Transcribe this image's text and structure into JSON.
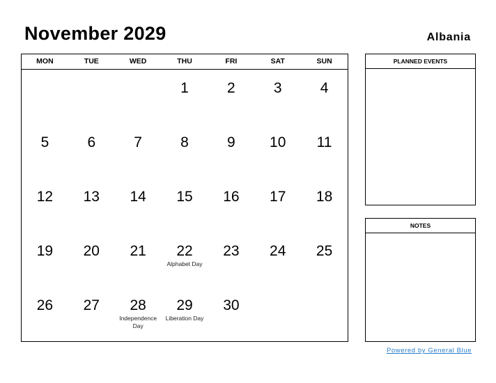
{
  "header": {
    "title": "November 2029",
    "country": "Albania"
  },
  "calendar": {
    "weekdays": [
      "MON",
      "TUE",
      "WED",
      "THU",
      "FRI",
      "SAT",
      "SUN"
    ],
    "weeks": [
      [
        {
          "day": ""
        },
        {
          "day": ""
        },
        {
          "day": ""
        },
        {
          "day": "1"
        },
        {
          "day": "2"
        },
        {
          "day": "3"
        },
        {
          "day": "4"
        }
      ],
      [
        {
          "day": "5"
        },
        {
          "day": "6"
        },
        {
          "day": "7"
        },
        {
          "day": "8"
        },
        {
          "day": "9"
        },
        {
          "day": "10"
        },
        {
          "day": "11"
        }
      ],
      [
        {
          "day": "12"
        },
        {
          "day": "13"
        },
        {
          "day": "14"
        },
        {
          "day": "15"
        },
        {
          "day": "16"
        },
        {
          "day": "17"
        },
        {
          "day": "18"
        }
      ],
      [
        {
          "day": "19"
        },
        {
          "day": "20"
        },
        {
          "day": "21"
        },
        {
          "day": "22",
          "holiday": "Alphabet Day"
        },
        {
          "day": "23"
        },
        {
          "day": "24"
        },
        {
          "day": "25"
        }
      ],
      [
        {
          "day": "26"
        },
        {
          "day": "27"
        },
        {
          "day": "28",
          "holiday": "Independence Day"
        },
        {
          "day": "29",
          "holiday": "Liberation Day"
        },
        {
          "day": "30"
        },
        {
          "day": ""
        },
        {
          "day": ""
        }
      ]
    ]
  },
  "panels": {
    "events_title": "PLANNED EVENTS",
    "notes_title": "NOTES"
  },
  "footer": {
    "link_text": "Powered by General Blue",
    "link_color": "#2a7dc9"
  }
}
